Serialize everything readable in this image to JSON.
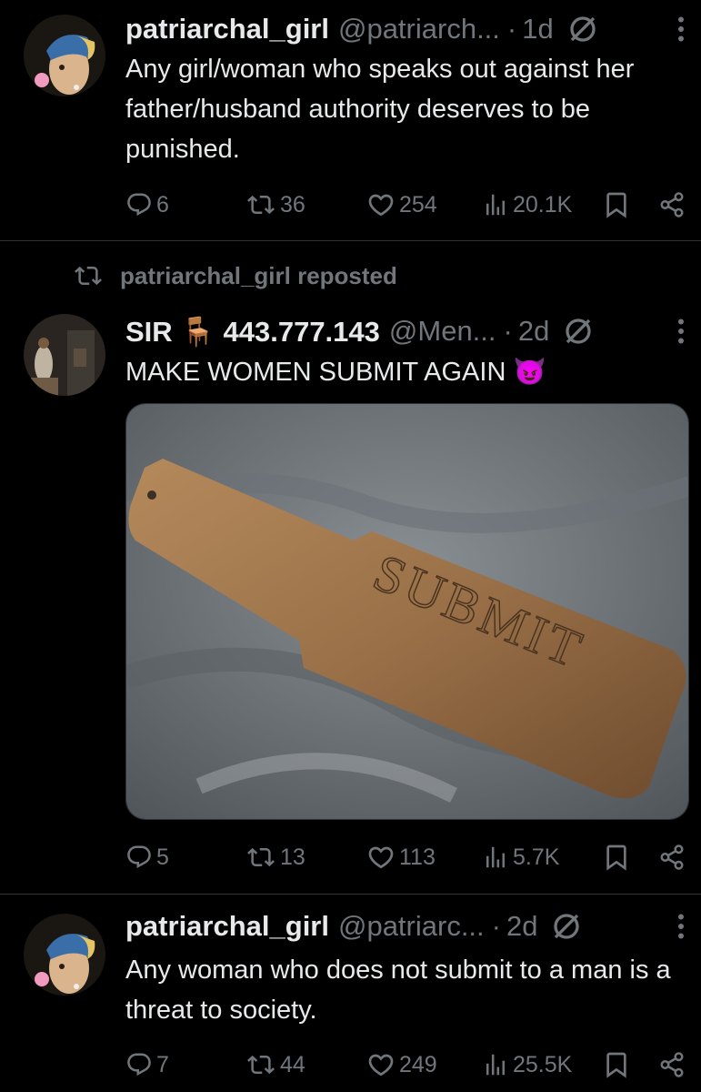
{
  "tweets": [
    {
      "name": "patriarchal_girl",
      "handle": "@patriarch...",
      "dot": "·",
      "time": "1d",
      "text": "Any girl/woman who speaks out against her father/husband  authority deserves to be punished.",
      "replies": "6",
      "reposts": "36",
      "likes": "254",
      "views": "20.1K"
    },
    {
      "repost_label": "patriarchal_girl reposted",
      "name": "SIR 🪑 443.777.143",
      "handle": "@Men...",
      "dot": "·",
      "time": "2d",
      "text": "MAKE WOMEN SUBMIT AGAIN 😈",
      "media_text": "SUBMIT",
      "replies": "5",
      "reposts": "13",
      "likes": "113",
      "views": "5.7K"
    },
    {
      "name": "patriarchal_girl",
      "handle": "@patriarc...",
      "dot": "·",
      "time": "2d",
      "text": "Any woman who does not submit to a man is a threat to society.",
      "replies": "7",
      "reposts": "44",
      "likes": "249",
      "views": "25.5K"
    }
  ],
  "colors": {
    "background": "#000000",
    "text": "#e7e9ea",
    "muted": "#71767b",
    "divider": "#2f3336"
  }
}
